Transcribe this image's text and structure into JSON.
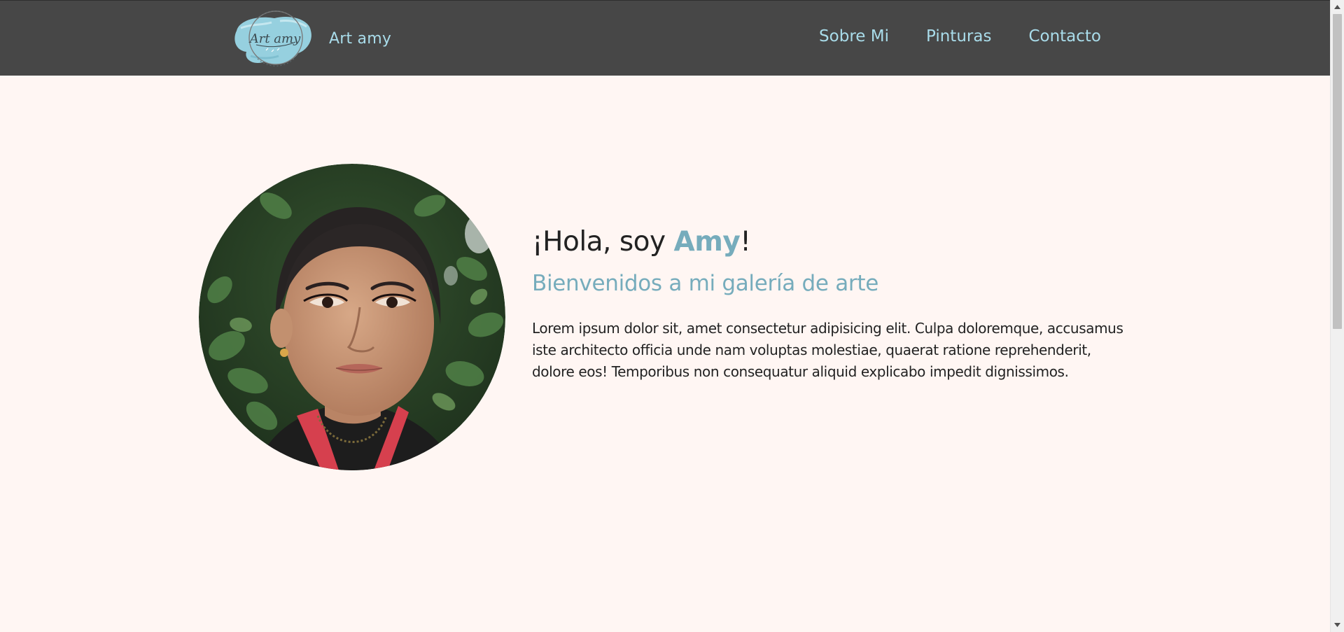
{
  "header": {
    "brand_name": "Art amy",
    "logo_text": "Art amy",
    "nav": [
      {
        "label": "Sobre Mi"
      },
      {
        "label": "Pinturas"
      },
      {
        "label": "Contacto"
      }
    ]
  },
  "hero": {
    "greeting_prefix": "¡Hola, soy ",
    "greeting_name": "Amy",
    "greeting_suffix": "!",
    "subtitle": "Bienvenidos a mi galería de arte",
    "bio": "Lorem ipsum dolor sit, amet consectetur adipisicing elit. Culpa doloremque, accusamus iste architecto officia unde nam voluptas molestiae, quaerat ratione reprehenderit, dolore eos! Temporibus non consequatur aliquid explicabo impedit dignissimos."
  },
  "colors": {
    "header_bg": "#474747",
    "accent": "#76acbc",
    "nav_text": "#a9dcea",
    "page_bg": "#fff6f3",
    "body_text": "#222222"
  }
}
